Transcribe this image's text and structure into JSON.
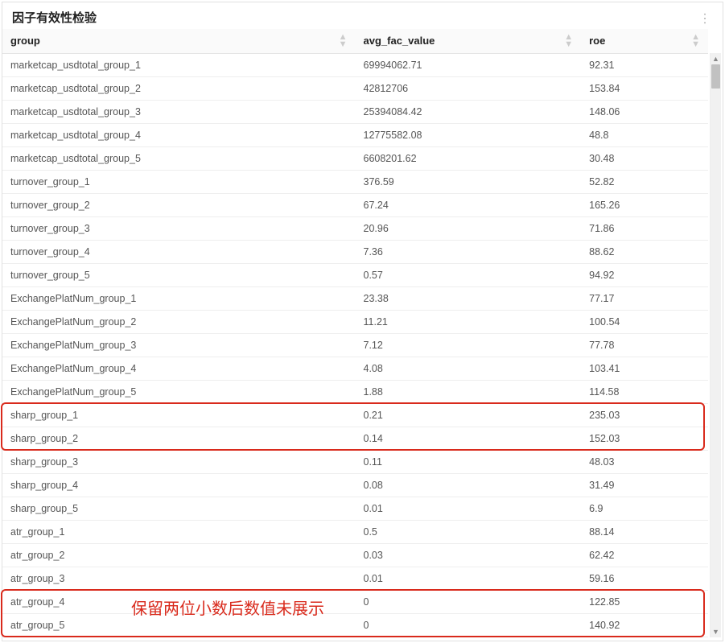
{
  "header": {
    "title": "因子有效性检验"
  },
  "columns": {
    "group": "group",
    "avg_fac_value": "avg_fac_value",
    "roe": "roe"
  },
  "rows": [
    {
      "group": "marketcap_usdtotal_group_1",
      "avg": "69994062.71",
      "roe": "92.31"
    },
    {
      "group": "marketcap_usdtotal_group_2",
      "avg": "42812706",
      "roe": "153.84"
    },
    {
      "group": "marketcap_usdtotal_group_3",
      "avg": "25394084.42",
      "roe": "148.06"
    },
    {
      "group": "marketcap_usdtotal_group_4",
      "avg": "12775582.08",
      "roe": "48.8"
    },
    {
      "group": "marketcap_usdtotal_group_5",
      "avg": "6608201.62",
      "roe": "30.48"
    },
    {
      "group": "turnover_group_1",
      "avg": "376.59",
      "roe": "52.82"
    },
    {
      "group": "turnover_group_2",
      "avg": "67.24",
      "roe": "165.26"
    },
    {
      "group": "turnover_group_3",
      "avg": "20.96",
      "roe": "71.86"
    },
    {
      "group": "turnover_group_4",
      "avg": "7.36",
      "roe": "88.62"
    },
    {
      "group": "turnover_group_5",
      "avg": "0.57",
      "roe": "94.92"
    },
    {
      "group": "ExchangePlatNum_group_1",
      "avg": "23.38",
      "roe": "77.17"
    },
    {
      "group": "ExchangePlatNum_group_2",
      "avg": "11.21",
      "roe": "100.54"
    },
    {
      "group": "ExchangePlatNum_group_3",
      "avg": "7.12",
      "roe": "77.78"
    },
    {
      "group": "ExchangePlatNum_group_4",
      "avg": "4.08",
      "roe": "103.41"
    },
    {
      "group": "ExchangePlatNum_group_5",
      "avg": "1.88",
      "roe": "114.58"
    },
    {
      "group": "sharp_group_1",
      "avg": "0.21",
      "roe": "235.03"
    },
    {
      "group": "sharp_group_2",
      "avg": "0.14",
      "roe": "152.03"
    },
    {
      "group": "sharp_group_3",
      "avg": "0.11",
      "roe": "48.03"
    },
    {
      "group": "sharp_group_4",
      "avg": "0.08",
      "roe": "31.49"
    },
    {
      "group": "sharp_group_5",
      "avg": "0.01",
      "roe": "6.9"
    },
    {
      "group": "atr_group_1",
      "avg": "0.5",
      "roe": "88.14"
    },
    {
      "group": "atr_group_2",
      "avg": "0.03",
      "roe": "62.42"
    },
    {
      "group": "atr_group_3",
      "avg": "0.01",
      "roe": "59.16"
    },
    {
      "group": "atr_group_4",
      "avg": "0",
      "roe": "122.85"
    },
    {
      "group": "atr_group_5",
      "avg": "0",
      "roe": "140.92"
    }
  ],
  "annotation": {
    "text": "保留两位小数后数值未展示"
  }
}
